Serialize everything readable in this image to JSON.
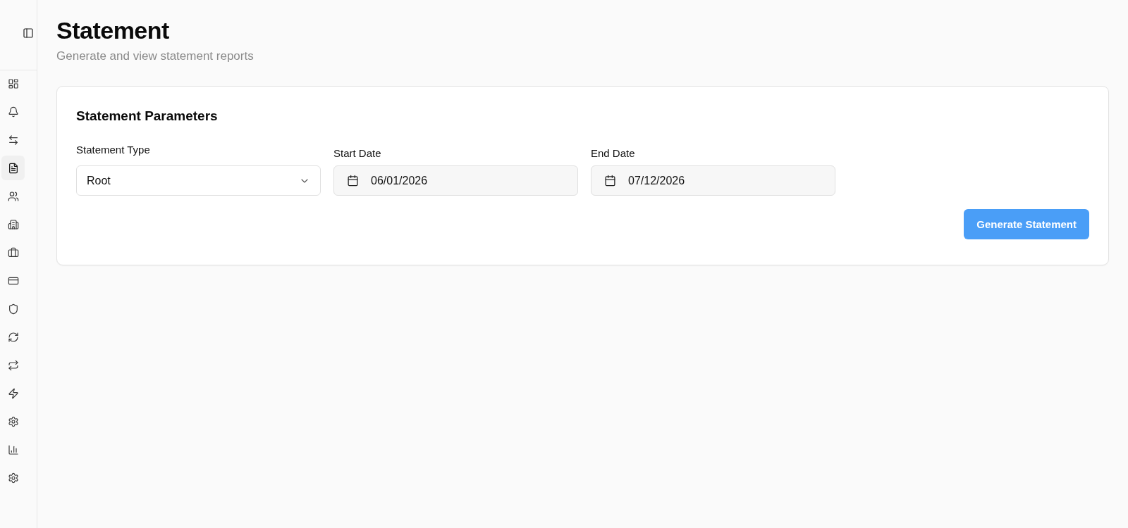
{
  "sidebar": {
    "items": [
      {
        "selected": false
      },
      {
        "selected": false
      },
      {
        "selected": false
      },
      {
        "selected": true
      },
      {
        "selected": false
      },
      {
        "selected": false
      },
      {
        "selected": false
      },
      {
        "selected": false
      },
      {
        "selected": false
      },
      {
        "selected": false
      },
      {
        "selected": false
      },
      {
        "selected": false
      },
      {
        "selected": false
      },
      {
        "selected": false
      },
      {
        "selected": false
      }
    ]
  },
  "page": {
    "title": "Statement",
    "subtitle": "Generate and view statement reports"
  },
  "card": {
    "title": "Statement Parameters",
    "fields": [
      {
        "kind": "select",
        "label": "Statement Type",
        "value": "Root"
      },
      {
        "kind": "date",
        "label": "Start Date",
        "value": "06/01/2026"
      },
      {
        "kind": "date",
        "label": "End Date",
        "value": "07/12/2026"
      }
    ],
    "button": {
      "label": "Generate Statement"
    }
  }
}
